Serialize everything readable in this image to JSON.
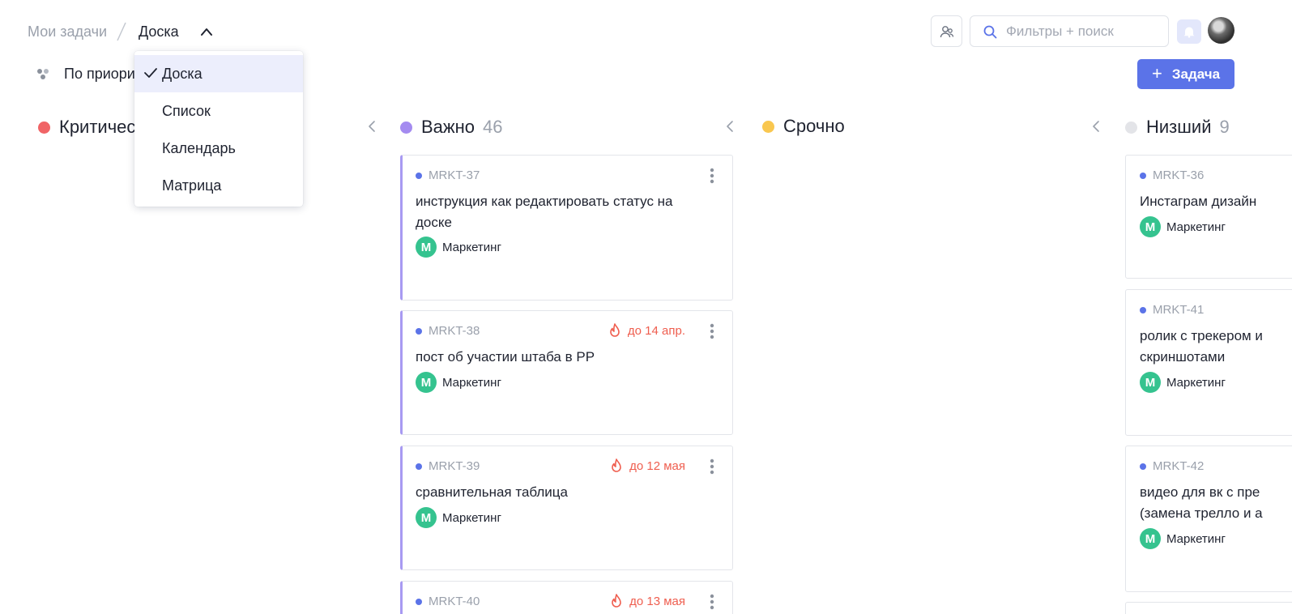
{
  "breadcrumb": {
    "root": "Мои задачи",
    "current": "Доска"
  },
  "search": {
    "placeholder": "Фильтры + поиск"
  },
  "toolbar": {
    "group_label": "По приоритету",
    "add_task_label": "Задача"
  },
  "view_menu": {
    "items": [
      {
        "label": "Доска",
        "selected": true
      },
      {
        "label": "Список",
        "selected": false
      },
      {
        "label": "Календарь",
        "selected": false
      },
      {
        "label": "Матрица",
        "selected": false
      }
    ]
  },
  "columns": [
    {
      "title": "Критичес",
      "count": "",
      "color": "#f06466"
    },
    {
      "title": "Важно",
      "count": "46",
      "color": "#a48bf0"
    },
    {
      "title": "Срочно",
      "count": "",
      "color": "#f9c74f"
    },
    {
      "title": "Низший",
      "count": "9",
      "color": "#e3e4e8"
    }
  ],
  "cards_important": [
    {
      "id": "MRKT-37",
      "title": "инструкция как редактировать статус на доске",
      "deadline": "",
      "project_initial": "М",
      "project": "Маркетинг"
    },
    {
      "id": "MRKT-38",
      "title": "пост об участии штаба в РР",
      "deadline": "до 14 апр.",
      "project_initial": "М",
      "project": "Маркетинг"
    },
    {
      "id": "MRKT-39",
      "title": "сравнительная таблица",
      "deadline": "до 12 мая",
      "project_initial": "М",
      "project": "Маркетинг"
    },
    {
      "id": "MRKT-40",
      "title": "",
      "deadline": "до 13 мая",
      "project_initial": "",
      "project": ""
    }
  ],
  "cards_low": [
    {
      "id": "MRKT-36",
      "title": "Инстаграм дизайн",
      "project_initial": "М",
      "project": "Маркетинг"
    },
    {
      "id": "MRKT-41",
      "title": "ролик с трекером и скриншотами",
      "project_initial": "М",
      "project": "Маркетинг"
    },
    {
      "id": "MRKT-42",
      "title": "видео для вк с пре (замена трелло и а",
      "project_initial": "М",
      "project": "Маркетинг"
    }
  ],
  "colors": {
    "accent": "#5b73e8",
    "deadline": "#ef5e4f",
    "project_badge": "#35c38f",
    "card_border_important": "#a89af2"
  }
}
